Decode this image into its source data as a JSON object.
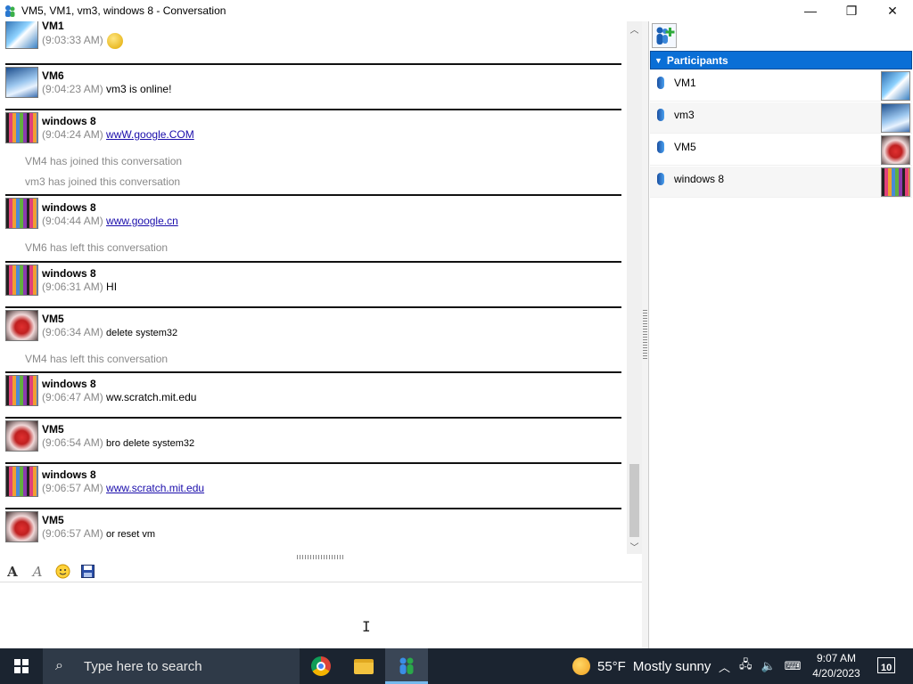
{
  "window": {
    "title": "VM5, VM1, vm3, windows 8 - Conversation",
    "minimize": "—",
    "maximize": "❐",
    "close": "✕"
  },
  "chat": {
    "messages": [
      {
        "sender": "VM1",
        "time": "(9:03:33 AM)",
        "text": ""
      },
      {
        "sender": "VM6",
        "time": "(9:04:23 AM)",
        "text": "vm3 is online!"
      },
      {
        "sender": "windows 8",
        "time": "(9:04:24 AM)",
        "text": "wwW.google.COM"
      },
      {
        "system": "VM4 has joined this conversation"
      },
      {
        "system": "vm3 has joined this conversation"
      },
      {
        "sender": "windows 8",
        "time": "(9:04:44 AM)",
        "text": "www.google.cn"
      },
      {
        "system": "VM6 has left this conversation"
      },
      {
        "sender": "windows 8",
        "time": "(9:06:31 AM)",
        "text": "HI"
      },
      {
        "sender": "VM5",
        "time": "(9:06:34 AM)",
        "text": "delete system32"
      },
      {
        "system": "VM4 has left this conversation"
      },
      {
        "sender": "windows 8",
        "time": "(9:06:47 AM)",
        "text": "ww.scratch.mit.edu"
      },
      {
        "sender": "VM5",
        "time": "(9:06:54 AM)",
        "text": "bro delete system32"
      },
      {
        "sender": "windows 8",
        "time": "(9:06:57 AM)",
        "text": "www.scratch.mit.edu"
      },
      {
        "sender": "VM5",
        "time": "(9:06:57 AM)",
        "text": "or reset vm"
      }
    ]
  },
  "toolbar": {
    "font_glyph": "A",
    "effects_glyph": "A"
  },
  "participants": {
    "header": "Participants",
    "items": [
      {
        "name": "VM1"
      },
      {
        "name": "vm3"
      },
      {
        "name": "VM5"
      },
      {
        "name": "windows 8"
      }
    ]
  },
  "taskbar": {
    "search_placeholder": "Type here to search",
    "weather_temp": "55°F",
    "weather_text": "Mostly sunny",
    "time": "9:07 AM",
    "date": "4/20/2023",
    "notification_count": "10"
  },
  "colors": {
    "participants_header": "#0a6fd6",
    "link": "#1a0dab",
    "taskbar": "#1b2430"
  },
  "icons": [
    "app-icon",
    "add-participant-icon",
    "font-icon",
    "effects-icon",
    "emoticon-icon",
    "save-icon",
    "windows-logo-icon",
    "search-icon",
    "chrome-icon",
    "folder-icon",
    "messenger-icon",
    "weather-icon",
    "network-icon",
    "volume-icon",
    "keyboard-icon",
    "notification-icon"
  ]
}
